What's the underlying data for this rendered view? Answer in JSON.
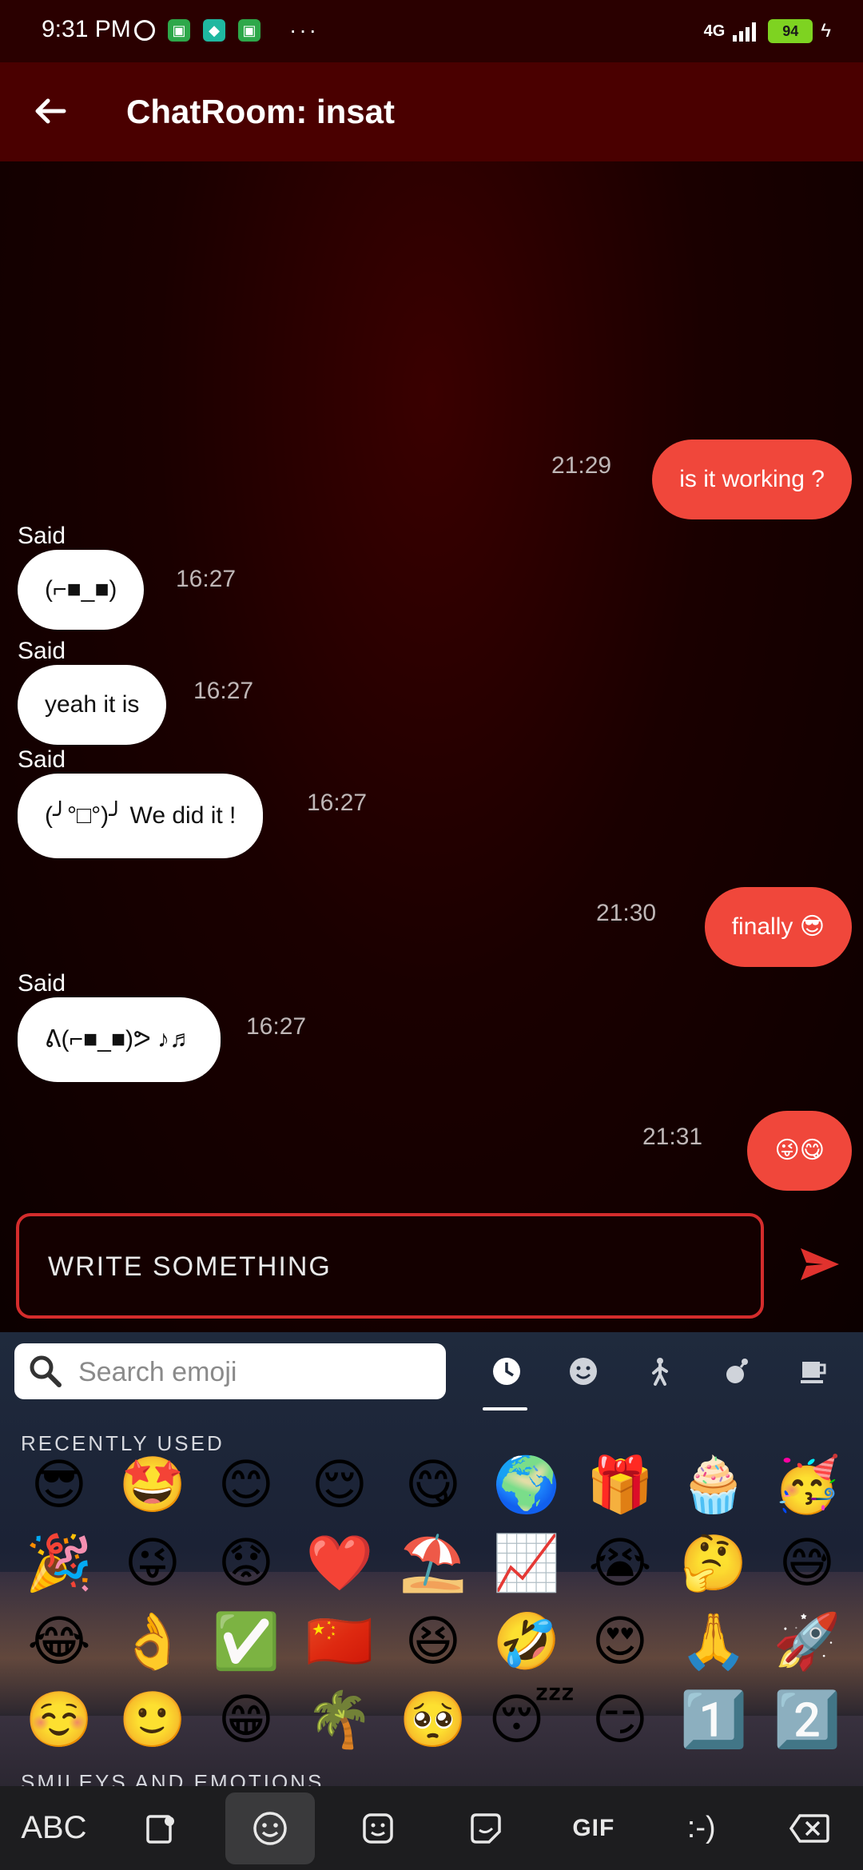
{
  "status": {
    "time": "9:31 PM",
    "network": "4G",
    "battery": "94"
  },
  "header": {
    "title": "ChatRoom: insat"
  },
  "messages": [
    {
      "type": "out",
      "text": "is it working ?",
      "time": "21:29"
    },
    {
      "type": "in",
      "sender": "Said",
      "text": "(⌐■_■)",
      "time": "16:27"
    },
    {
      "type": "in",
      "sender": "Said",
      "text": "yeah it is",
      "time": "16:27"
    },
    {
      "type": "in",
      "sender": "Said",
      "text": "(╯°□°)╯ We did it !",
      "time": "16:27"
    },
    {
      "type": "out",
      "text": "finally 😎",
      "time": "21:30"
    },
    {
      "type": "in",
      "sender": "Said",
      "text": "ᕕ(⌐■_■)ᕗ ♪♬",
      "time": "16:27"
    },
    {
      "type": "out",
      "text": "😜😋",
      "time": "21:31"
    }
  ],
  "composer": {
    "placeholder": "WRITE SOMETHING"
  },
  "emoji_keyboard": {
    "search_placeholder": "Search emoji",
    "recent_label": "RECENTLY USED",
    "next_section_label": "SMILEYS AND EMOTIONS",
    "emojis": [
      "😎",
      "🤩",
      "😊",
      "😌",
      "😋",
      "🌍",
      "🎁",
      "🧁",
      "🥳",
      "🎉",
      "😜",
      "😟",
      "❤️",
      "⛱️",
      "📈",
      "😭",
      "🤔",
      "😅",
      "😂",
      "👌",
      "✅",
      "🇨🇳",
      "😆",
      "🤣",
      "😍",
      "🙏",
      "🚀",
      "☺️",
      "🙂",
      "😁",
      "🌴",
      "🥺",
      "😴",
      "😏",
      "1️⃣",
      "2️⃣"
    ]
  },
  "keyboard_bar": {
    "abc": "ABC",
    "gif": "GIF",
    "emoticon": ":-)"
  }
}
